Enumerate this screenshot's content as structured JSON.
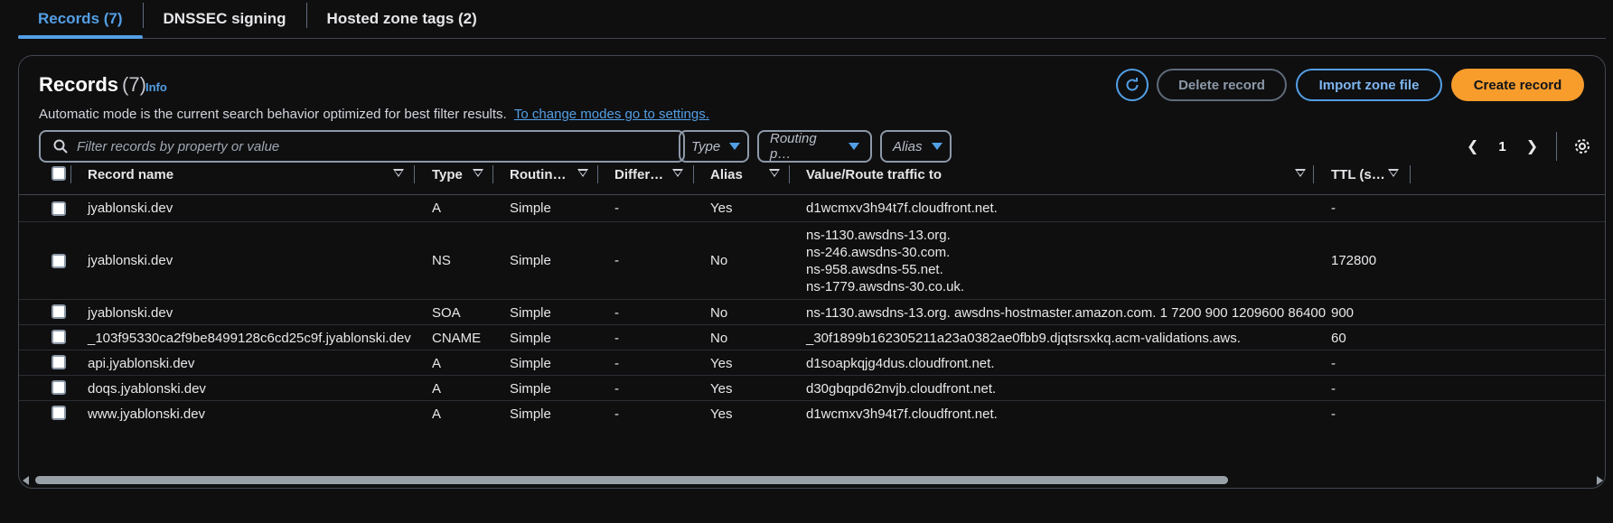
{
  "tabs": [
    {
      "label": "Records (7)",
      "active": true
    },
    {
      "label": "DNSSEC signing",
      "active": false
    },
    {
      "label": "Hosted zone tags (2)",
      "active": false
    }
  ],
  "records_panel": {
    "title": "Records",
    "count": "(7)",
    "info_label": "Info",
    "description": "Automatic mode is the current search behavior optimized for best filter results.",
    "settings_link": "To change modes go to settings.",
    "buttons": {
      "delete": "Delete record",
      "import": "Import zone file",
      "create": "Create record"
    },
    "search_placeholder": "Filter records by property or value",
    "filters": {
      "type": "Type",
      "routing": "Routing p…",
      "alias": "Alias"
    },
    "pagination": {
      "current_page": "1"
    }
  },
  "table": {
    "columns": {
      "record_name": "Record name",
      "type": "Type",
      "routing": "Routin…",
      "differentiator": "Differ…",
      "alias": "Alias",
      "value": "Value/Route traffic to",
      "ttl": "TTL (s…"
    },
    "rows": [
      {
        "name": "jyablonski.dev",
        "type": "A",
        "routing": "Simple",
        "diff": "-",
        "alias": "Yes",
        "value": [
          "d1wcmxv3h94t7f.cloudfront.net."
        ],
        "ttl": "-"
      },
      {
        "name": "jyablonski.dev",
        "type": "NS",
        "routing": "Simple",
        "diff": "-",
        "alias": "No",
        "value": [
          "ns-1130.awsdns-13.org.",
          "ns-246.awsdns-30.com.",
          "ns-958.awsdns-55.net.",
          "ns-1779.awsdns-30.co.uk."
        ],
        "ttl": "172800"
      },
      {
        "name": "jyablonski.dev",
        "type": "SOA",
        "routing": "Simple",
        "diff": "-",
        "alias": "No",
        "value": [
          "ns-1130.awsdns-13.org. awsdns-hostmaster.amazon.com. 1 7200 900 1209600 86400"
        ],
        "ttl": "900"
      },
      {
        "name": "_103f95330ca2f9be8499128c6cd25c9f.jyablonski.dev",
        "type": "CNAME",
        "routing": "Simple",
        "diff": "-",
        "alias": "No",
        "value": [
          "_30f1899b162305211a23a0382ae0fbb9.djqtsrsxkq.acm-validations.aws."
        ],
        "ttl": "60"
      },
      {
        "name": "api.jyablonski.dev",
        "type": "A",
        "routing": "Simple",
        "diff": "-",
        "alias": "Yes",
        "value": [
          "d1soapkqjg4dus.cloudfront.net."
        ],
        "ttl": "-"
      },
      {
        "name": "doqs.jyablonski.dev",
        "type": "A",
        "routing": "Simple",
        "diff": "-",
        "alias": "Yes",
        "value": [
          "d30gbqpd62nvjb.cloudfront.net."
        ],
        "ttl": "-"
      },
      {
        "name": "www.jyablonski.dev",
        "type": "A",
        "routing": "Simple",
        "diff": "-",
        "alias": "Yes",
        "value": [
          "d1wcmxv3h94t7f.cloudfront.net."
        ],
        "ttl": "-"
      }
    ]
  },
  "colors": {
    "accent": "#539fe5",
    "primary_button": "#f89c2c",
    "background": "#0f0f10",
    "border": "#414750"
  }
}
